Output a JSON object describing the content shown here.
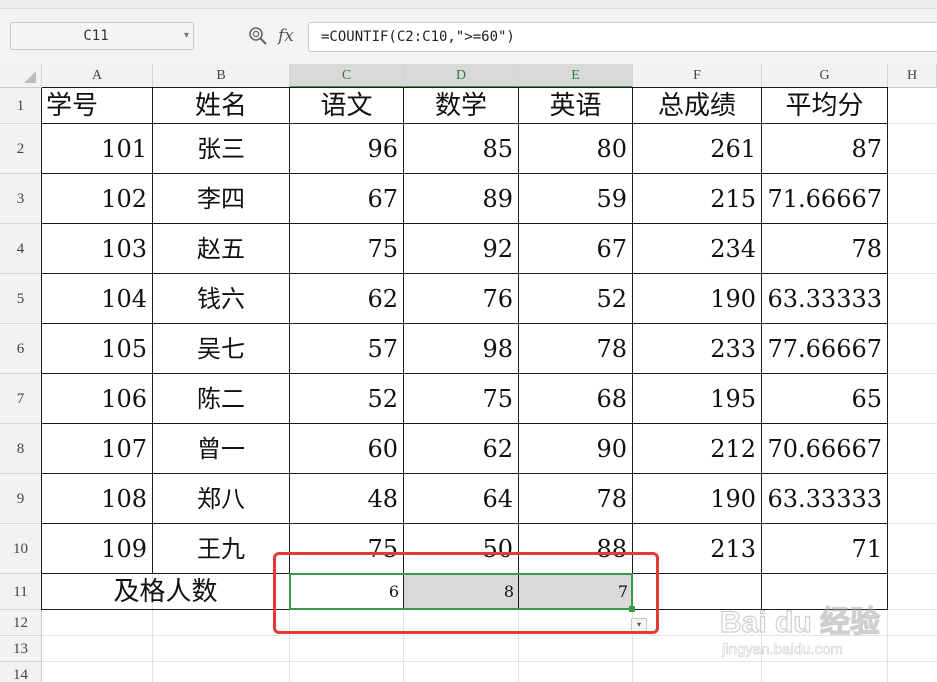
{
  "toolbar": {
    "name_box": "C11",
    "fx_label": "fx",
    "formula": "=COUNTIF(C2:C10,\">=60\")",
    "zoom_icon": "zoom-magnifier-icon",
    "dropdown_icon": "chevron-down-icon"
  },
  "columns": [
    "A",
    "B",
    "C",
    "D",
    "E",
    "F",
    "G",
    "H"
  ],
  "selected_columns": [
    "C",
    "D",
    "E"
  ],
  "rows": [
    "1",
    "2",
    "3",
    "4",
    "5",
    "6",
    "7",
    "8",
    "9",
    "10",
    "11",
    "12",
    "13",
    "14"
  ],
  "sheet": {
    "header": [
      "学号",
      "姓名",
      "语文",
      "数学",
      "英语",
      "总成绩",
      "平均分"
    ],
    "records": [
      [
        "101",
        "张三",
        "96",
        "85",
        "80",
        "261",
        "87"
      ],
      [
        "102",
        "李四",
        "67",
        "89",
        "59",
        "215",
        "71.66667"
      ],
      [
        "103",
        "赵五",
        "75",
        "92",
        "67",
        "234",
        "78"
      ],
      [
        "104",
        "钱六",
        "62",
        "76",
        "52",
        "190",
        "63.33333"
      ],
      [
        "105",
        "吴七",
        "57",
        "98",
        "78",
        "233",
        "77.66667"
      ],
      [
        "106",
        "陈二",
        "52",
        "75",
        "68",
        "195",
        "65"
      ],
      [
        "107",
        "曾一",
        "60",
        "62",
        "90",
        "212",
        "70.66667"
      ],
      [
        "108",
        "郑八",
        "48",
        "64",
        "78",
        "190",
        "63.33333"
      ],
      [
        "109",
        "王九",
        "75",
        "50",
        "88",
        "213",
        "71"
      ]
    ],
    "summary_label": "及格人数",
    "summary_values": [
      "6",
      "8",
      "7"
    ]
  },
  "colors": {
    "selection": "#3a9a4c",
    "highlight_box": "#e53935",
    "header_bg": "#f2f2f2",
    "selected_fill": "#d9d9d9"
  },
  "watermark": {
    "logo": "Bai du 经验",
    "url": "jingyan.baidu.com"
  }
}
